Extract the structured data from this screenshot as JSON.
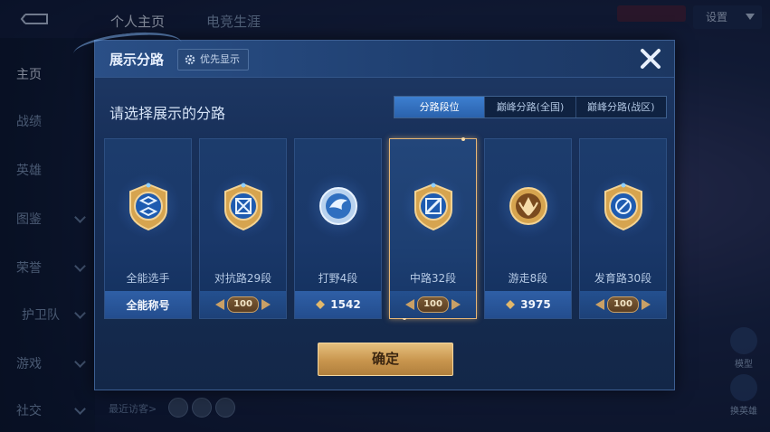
{
  "background": {
    "tabs": [
      "个人主页",
      "电竞生涯"
    ],
    "settings_label": "设置",
    "sidebar": [
      "主页",
      "战绩",
      "英雄",
      "图鉴",
      "荣誉",
      "护卫队",
      "游戏",
      "社交"
    ],
    "recent_visitors": "最近访客>",
    "right_buttons": [
      "模型",
      "换英雄"
    ]
  },
  "dialog": {
    "title": "展示分路",
    "priority_label": "优先显示",
    "subtitle": "请选择展示的分路",
    "segments": [
      "分路段位",
      "巅峰分路(全国)",
      "巅峰分路(战区)"
    ],
    "active_segment": 0,
    "cards": [
      {
        "name": "全能选手",
        "footer": "全能称号",
        "footer_type": "text",
        "emblem": "all-round-icon"
      },
      {
        "name": "对抗路29段",
        "footer": "100",
        "footer_type": "level",
        "emblem": "clash-lane-icon"
      },
      {
        "name": "打野4段",
        "footer": "1542",
        "footer_type": "points",
        "emblem": "jungle-icon"
      },
      {
        "name": "中路32段",
        "footer": "100",
        "footer_type": "level",
        "emblem": "mid-lane-icon",
        "selected": true
      },
      {
        "name": "游走8段",
        "footer": "3975",
        "footer_type": "points",
        "emblem": "roam-icon"
      },
      {
        "name": "发育路30段",
        "footer": "100",
        "footer_type": "level",
        "emblem": "farm-lane-icon"
      }
    ],
    "confirm_label": "确定"
  },
  "colors": {
    "accent_gold": "#e6b676",
    "active_tab": "#3d7fd0"
  }
}
